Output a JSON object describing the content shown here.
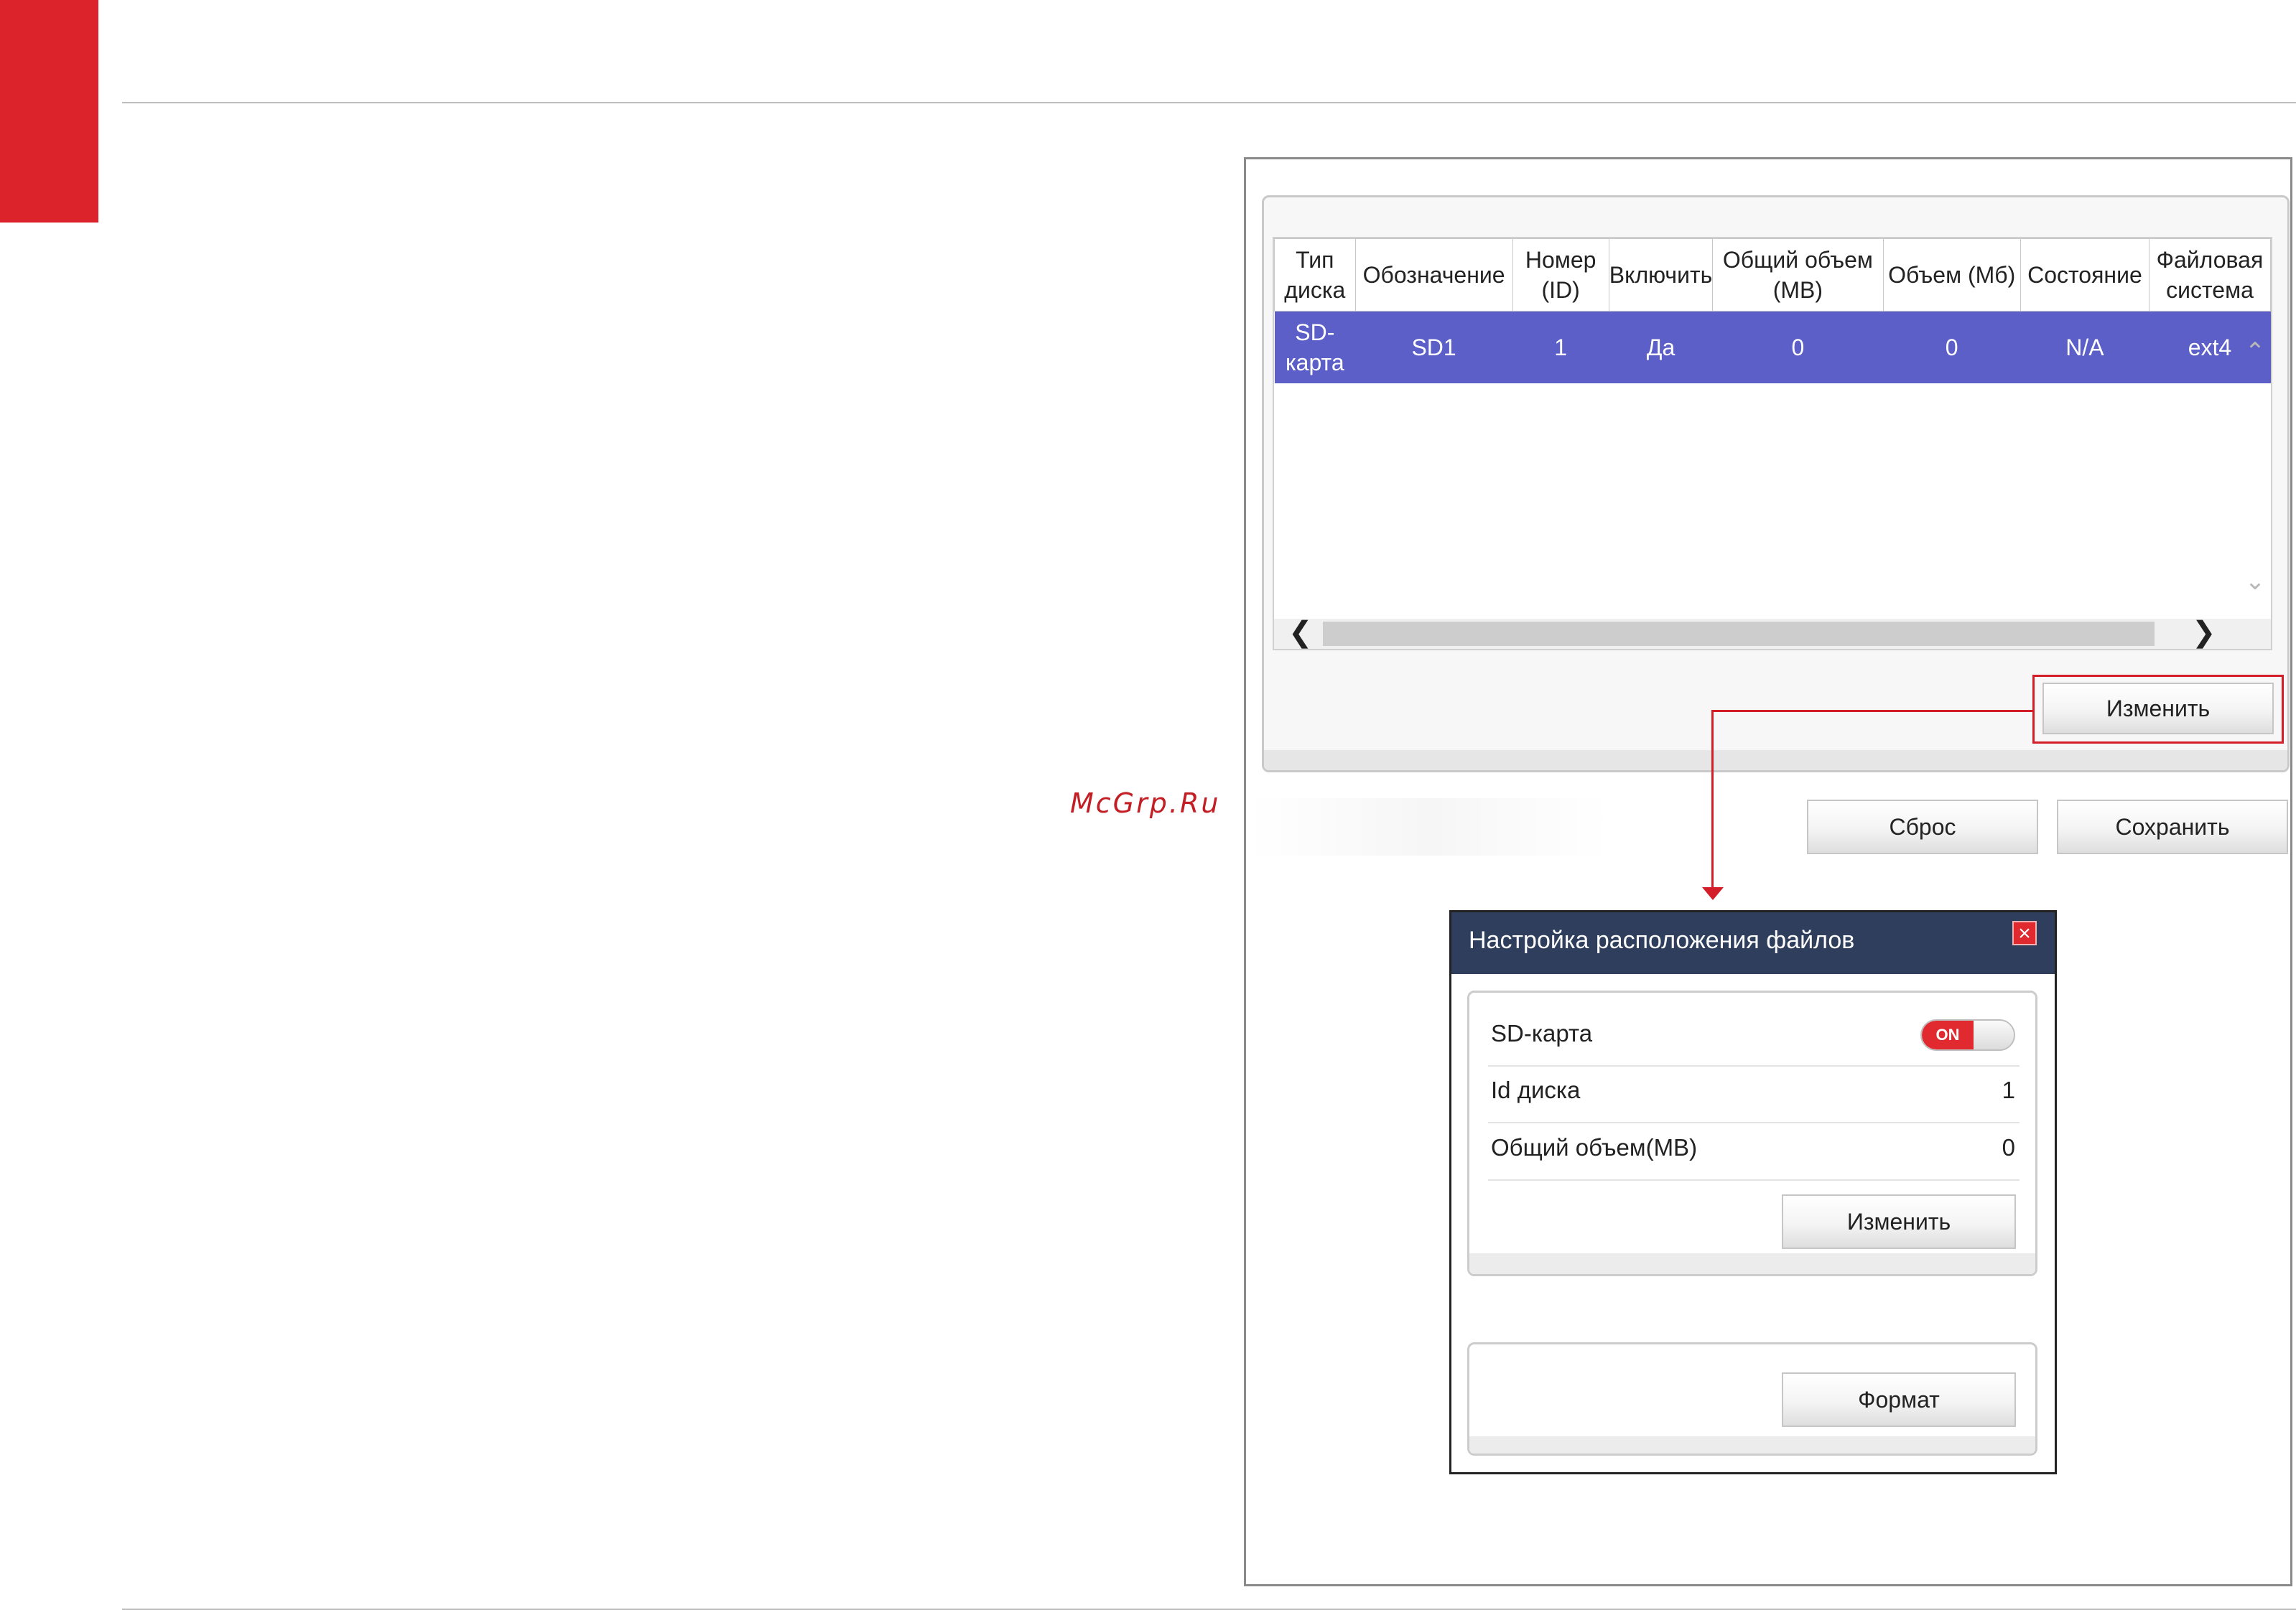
{
  "watermark": "McGrp.Ru",
  "storage_table": {
    "headers": [
      "Тип\nдиска",
      "Обозначение",
      "Номер\n(ID)",
      "Включить",
      "Общий объем\n(MB)",
      "Объем (Мб)",
      "Состояние",
      "Файловая\nсистема"
    ],
    "rows": [
      [
        "SD-\nкарта",
        "SD1",
        "1",
        "Да",
        "0",
        "0",
        "N/A",
        "ext4"
      ]
    ],
    "selected_row_color": "#5b5fc7"
  },
  "panel": {
    "edit_button_label": "Изменить"
  },
  "actions": {
    "reset_label": "Сброс",
    "save_label": "Сохранить"
  },
  "dialog": {
    "title": "Настройка расположения файлов",
    "close_icon": "close-icon",
    "sd_card_label": "SD-карта",
    "sd_card_toggle": "ON",
    "disk_id_label": "Id диска",
    "disk_id_value": "1",
    "total_volume_label": "Общий объем(MB)",
    "total_volume_value": "0",
    "edit_button_label": "Изменить",
    "format_button_label": "Формат"
  },
  "colors": {
    "brand_red": "#dc232c",
    "dialog_header": "#2f3e5c",
    "highlight_red": "#d31e2a"
  }
}
